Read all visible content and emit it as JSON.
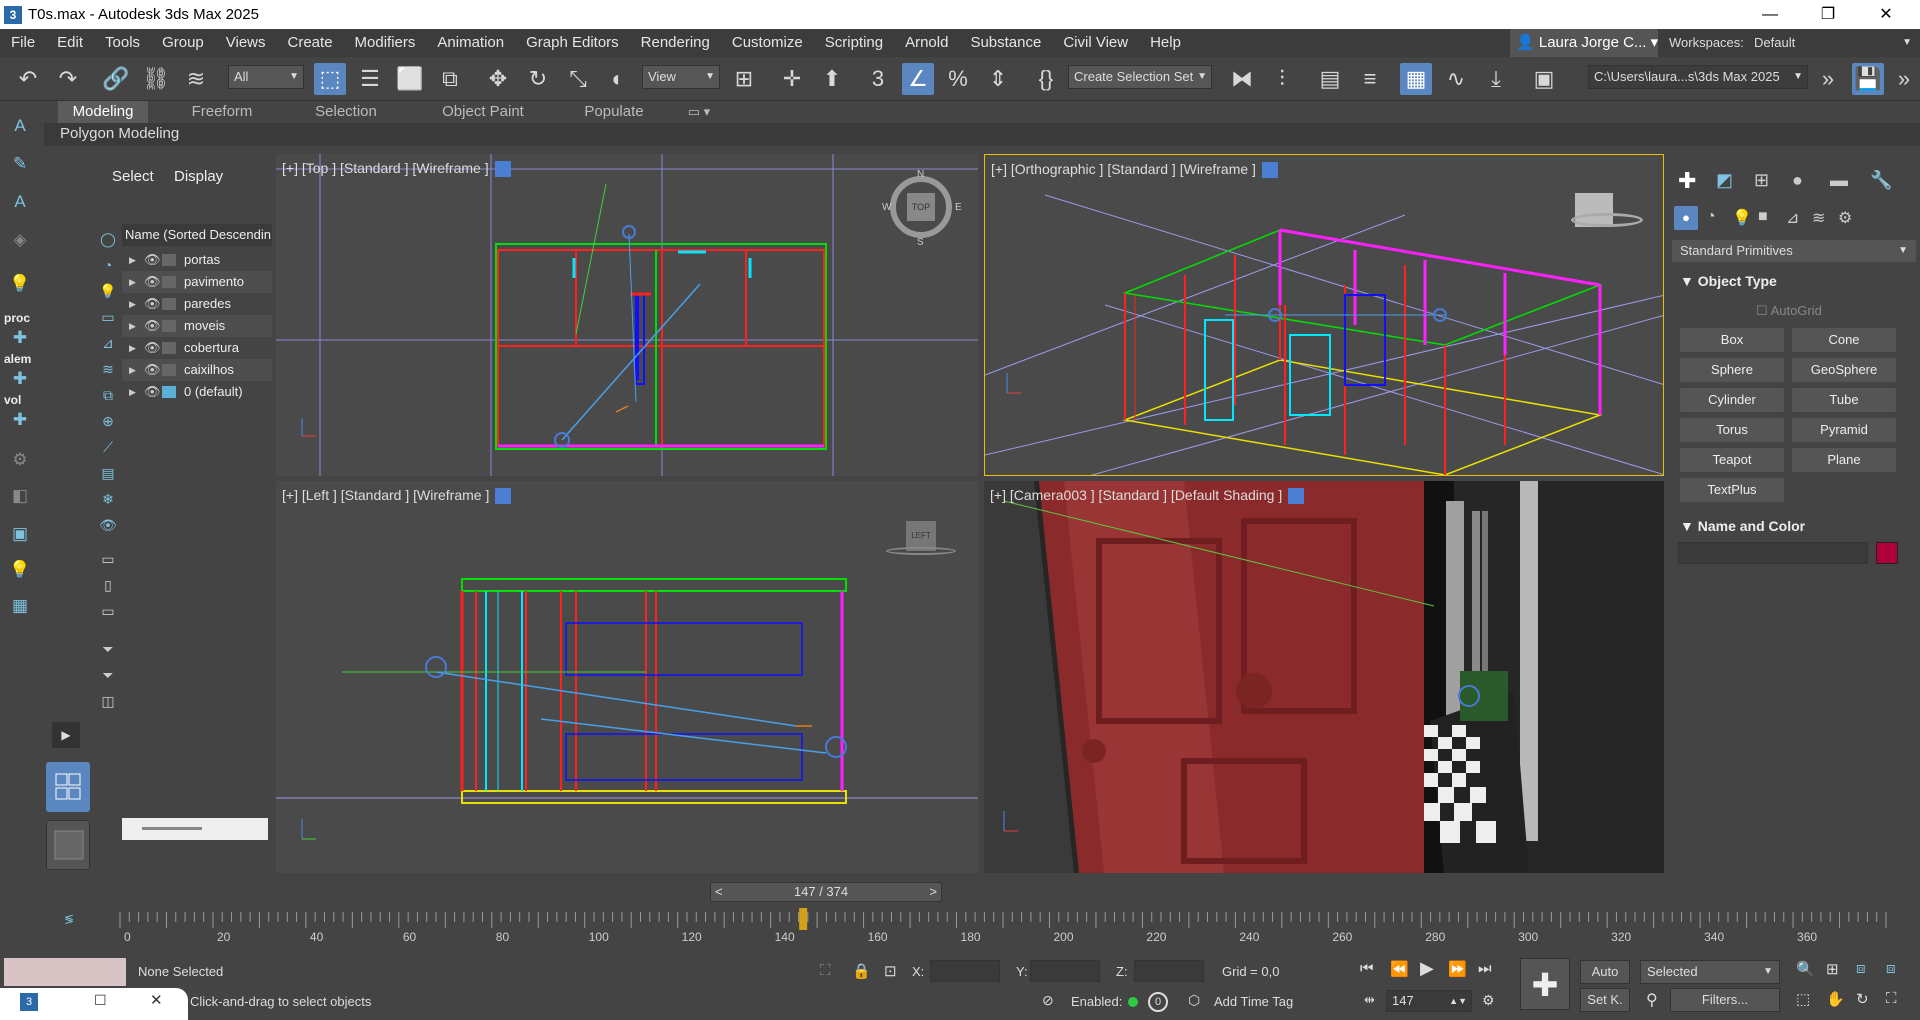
{
  "window": {
    "title": "T0s.max - Autodesk 3ds Max 2025",
    "minimize": "—",
    "maximize": "❐",
    "close": "✕"
  },
  "menu": [
    "File",
    "Edit",
    "Tools",
    "Group",
    "Views",
    "Create",
    "Modifiers",
    "Animation",
    "Graph Editors",
    "Rendering",
    "Customize",
    "Scripting",
    "Arnold",
    "Substance",
    "Civil View",
    "Help"
  ],
  "user": {
    "name": "Laura Jorge C...",
    "arrow": "▾"
  },
  "workspaces": {
    "label": "Workspaces:",
    "value": "Default"
  },
  "toolbar": {
    "filter": "All",
    "refcoord": "View",
    "selset": "Create Selection Set",
    "path": "C:\\Users\\laura...s\\3ds Max 2025",
    "snap_label": "3",
    "percent": "%"
  },
  "ribbon": {
    "tabs": [
      "Modeling",
      "Freeform",
      "Selection",
      "Object Paint",
      "Populate"
    ],
    "active": "Modeling",
    "panel": "Polygon Modeling"
  },
  "left_labels": {
    "proc": "proc",
    "alem": "alem",
    "vol": "vol"
  },
  "scene_explorer": {
    "tabs": [
      "Select",
      "Display"
    ],
    "column": "Name (Sorted Descendin",
    "layers": [
      "portas",
      "pavimento",
      "paredes",
      "moveis",
      "cobertura",
      "caixilhos",
      "0 (default)"
    ]
  },
  "viewports": {
    "top": {
      "label": "[+] [Top ] [Standard ] [Wireframe ]",
      "cube": "TOP",
      "n": "N",
      "s": "S",
      "e": "E",
      "w": "W"
    },
    "ortho": {
      "label": "[+] [Orthographic ] [Standard ] [Wireframe ]"
    },
    "left": {
      "label": "[+] [Left ] [Standard ] [Wireframe ]",
      "cube": "LEFT"
    },
    "camera": {
      "label": "[+] [Camera003 ] [Standard ] [Default Shading ]"
    }
  },
  "command_panel": {
    "category": "Standard Primitives",
    "object_type": "Object Type",
    "autogrid": "AutoGrid",
    "buttons": [
      "Box",
      "Cone",
      "Sphere",
      "GeoSphere",
      "Cylinder",
      "Tube",
      "Torus",
      "Pyramid",
      "Teapot",
      "Plane",
      "TextPlus"
    ],
    "name_color": "Name and Color",
    "color": "#b0003a"
  },
  "timeline": {
    "frame": "147 / 374",
    "prev": "<",
    "next": ">",
    "ticks": [
      "0",
      "20",
      "40",
      "60",
      "80",
      "100",
      "120",
      "140",
      "160",
      "180",
      "200",
      "220",
      "240",
      "260",
      "280",
      "300",
      "320",
      "340",
      "360"
    ],
    "current": 147,
    "total": 374
  },
  "status": {
    "selected": "None Selected",
    "prompt": "Click-and-drag to select objects",
    "x_label": "X:",
    "y_label": "Y:",
    "z_label": "Z:",
    "grid": "Grid = 0,0",
    "enabled": "Enabled:",
    "enabled_val": "0",
    "add_tag": "Add Time Tag",
    "auto": "Auto",
    "setk": "Set K.",
    "selected_mode": "Selected",
    "filters": "Filters...",
    "frame_input": "147"
  }
}
